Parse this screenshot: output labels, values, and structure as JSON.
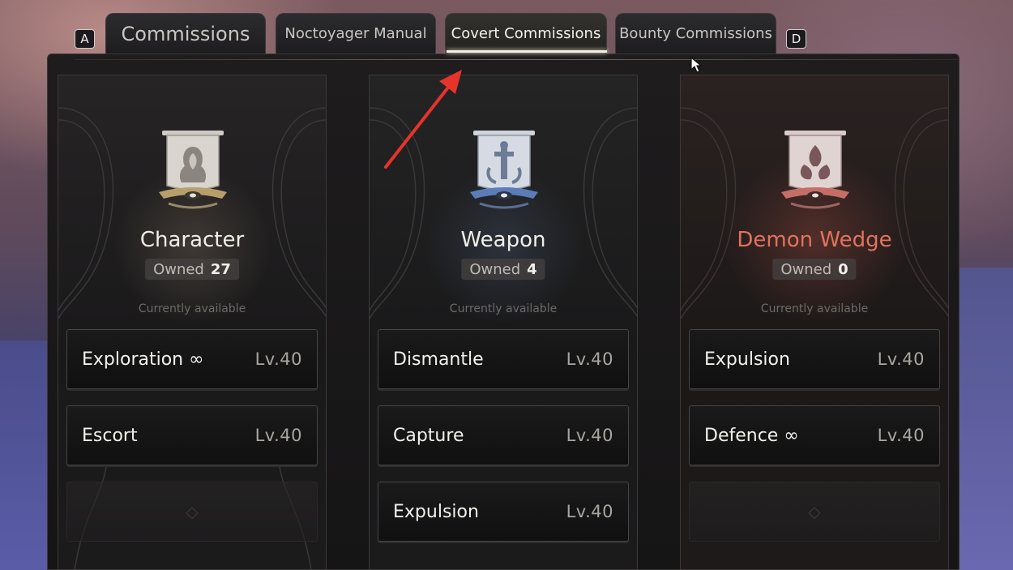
{
  "key_hints": {
    "left": "A",
    "right": "D"
  },
  "tabs": [
    {
      "label": "Commissions"
    },
    {
      "label": "Noctoyager Manual"
    },
    {
      "label": "Covert Commissions"
    },
    {
      "label": "Bounty Commissions"
    }
  ],
  "active_tab": "Covert Commissions",
  "cards": [
    {
      "title": "Character",
      "owned_label": "Owned",
      "owned_count": "27",
      "availability": "Currently available",
      "missions": [
        {
          "name": "Exploration ∞",
          "level": "Lv.40"
        },
        {
          "name": "Escort",
          "level": "Lv.40"
        }
      ]
    },
    {
      "title": "Weapon",
      "owned_label": "Owned",
      "owned_count": "4",
      "availability": "Currently available",
      "missions": [
        {
          "name": "Dismantle",
          "level": "Lv.40"
        },
        {
          "name": "Capture",
          "level": "Lv.40"
        },
        {
          "name": "Expulsion",
          "level": "Lv.40"
        }
      ]
    },
    {
      "title": "Demon Wedge",
      "owned_label": "Owned",
      "owned_count": "0",
      "availability": "Currently available",
      "missions": [
        {
          "name": "Expulsion",
          "level": "Lv.40"
        },
        {
          "name": "Defence ∞",
          "level": "Lv.40"
        }
      ]
    }
  ],
  "colors": {
    "accent_title_demon": "#e0735f",
    "tab_underline": "#f4efe2",
    "annotation_arrow": "#e5342b"
  },
  "icons": {
    "character_emblem": "hooded-figure-banner-icon",
    "weapon_emblem": "sword-banner-icon",
    "demon_wedge_emblem": "triquetra-banner-icon"
  }
}
